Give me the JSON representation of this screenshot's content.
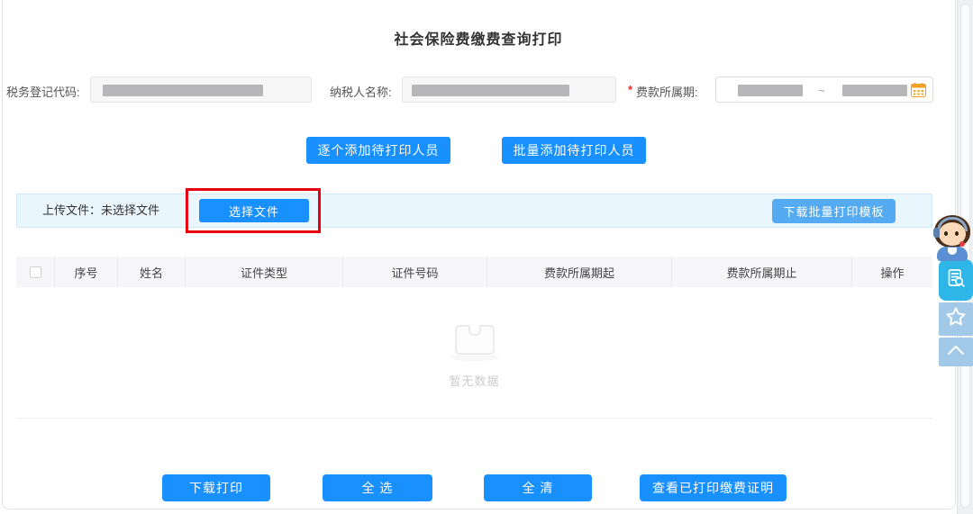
{
  "page": {
    "title": "社会保险费缴费查询打印"
  },
  "form": {
    "tax_code_label": "税务登记代码:",
    "tax_code_value": "",
    "taxpayer_label": "纳税人名称:",
    "taxpayer_value": "",
    "required_mark": "*",
    "period_label": "费款所属期:",
    "period_start_value": "",
    "period_end_value": "",
    "range_separator": "~"
  },
  "mid_actions": {
    "add_single": "逐个添加待打印人员",
    "add_batch": "批量添加待打印人员"
  },
  "upload": {
    "label": "上传文件：未选择文件",
    "choose_file": "选择文件",
    "download_template": "下载批量打印模板"
  },
  "table": {
    "headers": [
      "序号",
      "姓名",
      "证件类型",
      "证件号码",
      "费款所属期起",
      "费款所属期止",
      "操作"
    ],
    "rows": [],
    "empty_text": "暂无数据"
  },
  "footer_actions": {
    "download_print": "下载打印",
    "select_all": "全 选",
    "clear_all": "全 清",
    "view_printed": "查看已打印缴费证明"
  },
  "icons": {
    "calendar": "calendar-icon",
    "doc_search": "document-search-icon",
    "star": "star-icon",
    "back_to_top": "chevron-up-icon",
    "mascot": "customer-service-avatar",
    "empty_box": "empty-box-icon"
  },
  "colors": {
    "primary_button": "#1890ff",
    "light_button": "#55abf1",
    "upload_bar_bg": "#eaf6fe",
    "annotation_red": "#e60012",
    "calendar_orange": "#f0a125",
    "sidebar_active": "#2fb6e9",
    "sidebar_muted": "#a3c9e9"
  }
}
